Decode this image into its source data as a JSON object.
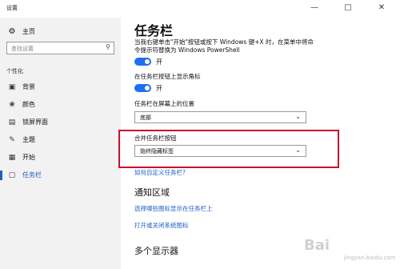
{
  "window": {
    "title": "设置",
    "minimize_icon": "minimize-icon",
    "maximize_icon": "maximize-icon",
    "close_icon": "close-icon"
  },
  "sidebar": {
    "home_label": "主页",
    "search_placeholder": "查找设置",
    "section_title": "个性化",
    "items": [
      {
        "label": "背景",
        "icon": "image-icon"
      },
      {
        "label": "颜色",
        "icon": "palette-icon"
      },
      {
        "label": "锁屏界面",
        "icon": "lockscreen-icon"
      },
      {
        "label": "主题",
        "icon": "brush-icon"
      },
      {
        "label": "开始",
        "icon": "start-icon"
      },
      {
        "label": "任务栏",
        "icon": "taskbar-icon",
        "active": true
      }
    ]
  },
  "main": {
    "title": "任务栏",
    "powershell_text_line1": "当我右键单击\"开始\"按钮或按下 Windows 键+X 时，在菜单中将命",
    "powershell_text_line2": "令提示符替换为 Windows PowerShell",
    "toggle1_state": "开",
    "badges_label": "在任务栏按钮上显示角标",
    "toggle2_state": "开",
    "position_label": "任务栏在屏幕上的位置",
    "position_value": "底部",
    "combine_label": "合并任务栏按钮",
    "combine_value": "始终隐藏标签",
    "customize_link": "如何自定义任务栏?",
    "notification_title": "通知区域",
    "notification_link1": "选择哪些图标显示在任务栏上",
    "notification_link2": "打开或关闭系统图标",
    "multi_display_title": "多个显示器"
  },
  "watermark": {
    "text": "Bai",
    "sub": "jingyan.baidu.com"
  },
  "colors": {
    "accent": "#1d6ff2",
    "link": "#1e5fc6",
    "highlight_box": "#c8102e"
  }
}
